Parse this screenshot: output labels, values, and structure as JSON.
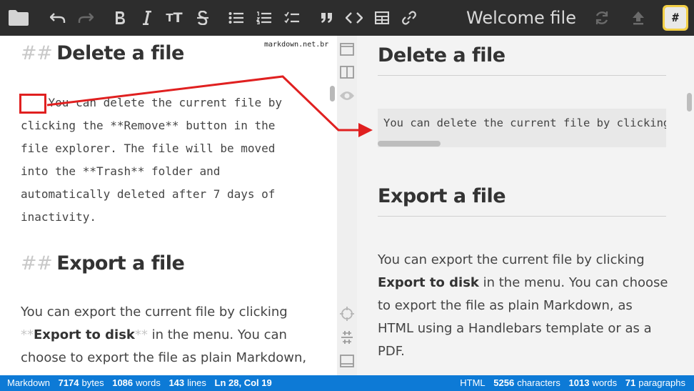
{
  "toolbar": {
    "title": "Welcome file",
    "icons": [
      "folder-icon",
      "undo-icon",
      "redo-icon",
      "bold-icon",
      "italic-icon",
      "heading-icon",
      "strikethrough-icon",
      "unordered-list-icon",
      "ordered-list-icon",
      "checklist-icon",
      "quote-icon",
      "code-icon",
      "table-icon",
      "link-icon",
      "sync-icon",
      "publish-icon",
      "workspace-icon"
    ],
    "heading_glyph": "T",
    "hash_label": "#"
  },
  "editor": {
    "watermark": "markdown.net.br",
    "delete_heading": {
      "hashes": "##",
      "text": "Delete a file"
    },
    "delete_code_lines": [
      "    You can delete the current file by",
      "clicking the **Remove** button in the",
      "file explorer. The file will be moved",
      "into the **Trash** folder and",
      "automatically deleted after 7 days of",
      "inactivity."
    ],
    "export_heading": {
      "hashes": "##",
      "text": "Export a file"
    },
    "export_para": {
      "before": "You can export the current file by clicking ",
      "mark_open": "**",
      "bold": "Export to disk",
      "mark_close": "**",
      "after": " in the menu. You can choose to export the file as plain Markdown, as HTML"
    }
  },
  "side_buttons": [
    "toggle-sidebar-icon",
    "split-view-icon",
    "preview-icon",
    "scroll-sync-icon",
    "navigation-bar-icon",
    "status-bar-icon"
  ],
  "preview": {
    "delete_heading": "Delete a file",
    "code_line": "You can delete the current file by clicking the **Remove** button in the file explorer.",
    "export_heading": "Export a file",
    "export_para": {
      "before": "You can export the current file by clicking ",
      "bold": "Export to disk",
      "after": " in the menu. You can choose to export the file as plain Markdown, as HTML using a Handlebars template or as a PDF."
    }
  },
  "status": {
    "left": {
      "mode": "Markdown",
      "bytes": "7174",
      "bytes_label": "bytes",
      "words": "1086",
      "words_label": "words",
      "lines": "143",
      "lines_label": "lines",
      "position": "Ln 28, Col 19"
    },
    "right": {
      "mode": "HTML",
      "characters": "5256",
      "characters_label": "characters",
      "words": "1013",
      "words_label": "words",
      "paragraphs": "71",
      "paragraphs_label": "paragraphs"
    }
  },
  "colors": {
    "toolbar_bg": "#2d2d2d",
    "status_bg": "#0d7ad6",
    "annotation": "#e02020",
    "hash_button_ring": "#f2cf46"
  }
}
